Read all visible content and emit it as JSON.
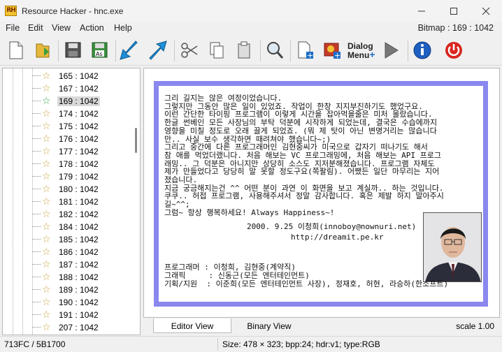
{
  "window": {
    "title": "Resource Hacker - hnc.exe",
    "icon_text": "RH"
  },
  "menu": {
    "items": [
      "File",
      "Edit",
      "View",
      "Action",
      "Help"
    ],
    "bitmap_info": "Bitmap : 169 : 1042"
  },
  "toolbar": {
    "dialog_menu_label_line1": "Dialog",
    "dialog_menu_label_line2": "Menu",
    "buttons": [
      "new-file",
      "open-file",
      "save",
      "save-as",
      "compile-back",
      "compile",
      "cut",
      "copy",
      "paste",
      "find",
      "add-resource",
      "add-image",
      "dialog-menu",
      "play",
      "info",
      "power"
    ]
  },
  "tree": {
    "items": [
      {
        "label": "165 : 1042",
        "selected": false
      },
      {
        "label": "167 : 1042",
        "selected": false
      },
      {
        "label": "169 : 1042",
        "selected": true
      },
      {
        "label": "174 : 1042",
        "selected": false
      },
      {
        "label": "175 : 1042",
        "selected": false
      },
      {
        "label": "176 : 1042",
        "selected": false
      },
      {
        "label": "177 : 1042",
        "selected": false
      },
      {
        "label": "178 : 1042",
        "selected": false
      },
      {
        "label": "179 : 1042",
        "selected": false
      },
      {
        "label": "180 : 1042",
        "selected": false
      },
      {
        "label": "181 : 1042",
        "selected": false
      },
      {
        "label": "182 : 1042",
        "selected": false
      },
      {
        "label": "184 : 1042",
        "selected": false
      },
      {
        "label": "185 : 1042",
        "selected": false
      },
      {
        "label": "186 : 1042",
        "selected": false
      },
      {
        "label": "187 : 1042",
        "selected": false
      },
      {
        "label": "188 : 1042",
        "selected": false
      },
      {
        "label": "189 : 1042",
        "selected": false
      },
      {
        "label": "190 : 1042",
        "selected": false
      },
      {
        "label": "191 : 1042",
        "selected": false
      },
      {
        "label": "207 : 1042",
        "selected": false
      }
    ]
  },
  "bitmap": {
    "lines": [
      "그리 길지는 않은 여정이었습니다.",
      "그렇지만 그동안 많은 일이 있었죠. 작업이 한창 지지부진하기도 했었구요.",
      "이런 간단한 타이핑 프로그램이 이렇게 시간을 잡아먹을줄은 미처 몰랐습니다.",
      "한글 썬베인 모든 사장님의 부탁 덕분에 시작하게 되었는데, 결국은 수습에까지",
      "영향을 미칠 정도로 오래 끌게 되었죠. (뭐 제 탓이 아닌 변명거리는 많습니다",
      "만.. 사실 보수 생각하면 때려쳐야 했습니다~;)",
      "그리고 중간에 다른 프로그래머인 김현중씨가 미국으로 갑자기 떠나기도 해서",
      "참 애를 먹었더랬니다. 처음 해보는 VC 프로그래밍에, 처음 해보는 API 프로그",
      "래밍.. 그 덕분은 아니지만 상당히 소스도 지저분해졌습니다. 프로그램 자체도",
      "제가 만들었다고 당당히 말 못할 정도구요(쪽팔림). 어쨌든 일단 마무리는 지어",
      "졌습니다.",
      "지금 궁금해지는건 ^^ 어떤 분이 과연 이 화면을 보고 계실까.. 하는 것입니다.",
      "쿠쿠.. 허접 프로그램, 사용해주셔서 정말 감사합니다. 혹은 제발 하지 말아주시",
      "길~^^;",
      "그럼~ 항상 행복하세요! Always Happiness~!"
    ],
    "signature_line1": "2000. 9.25 이청희(innoboy@nownuri.net)",
    "signature_line2": "http://dreamit.pe.kr",
    "credits": [
      "프로그래머 : 이청희, 김현중(계약직)",
      "그래픽     : 신동근(모든 엔터테인먼트)",
      "기획/지원  : 이준희(모든 엔터테인먼트 사장), 정재호, 허현, 라승하(한소프트)"
    ],
    "border_color": "#8a87ee"
  },
  "tabs": {
    "editor": "Editor View",
    "binary": "Binary View",
    "scale": "scale 1.00"
  },
  "status": {
    "left": "713FC / 5B1700",
    "right": "Size: 478 × 323;  bpp:24;  hdr:v1;  type:RGB"
  }
}
